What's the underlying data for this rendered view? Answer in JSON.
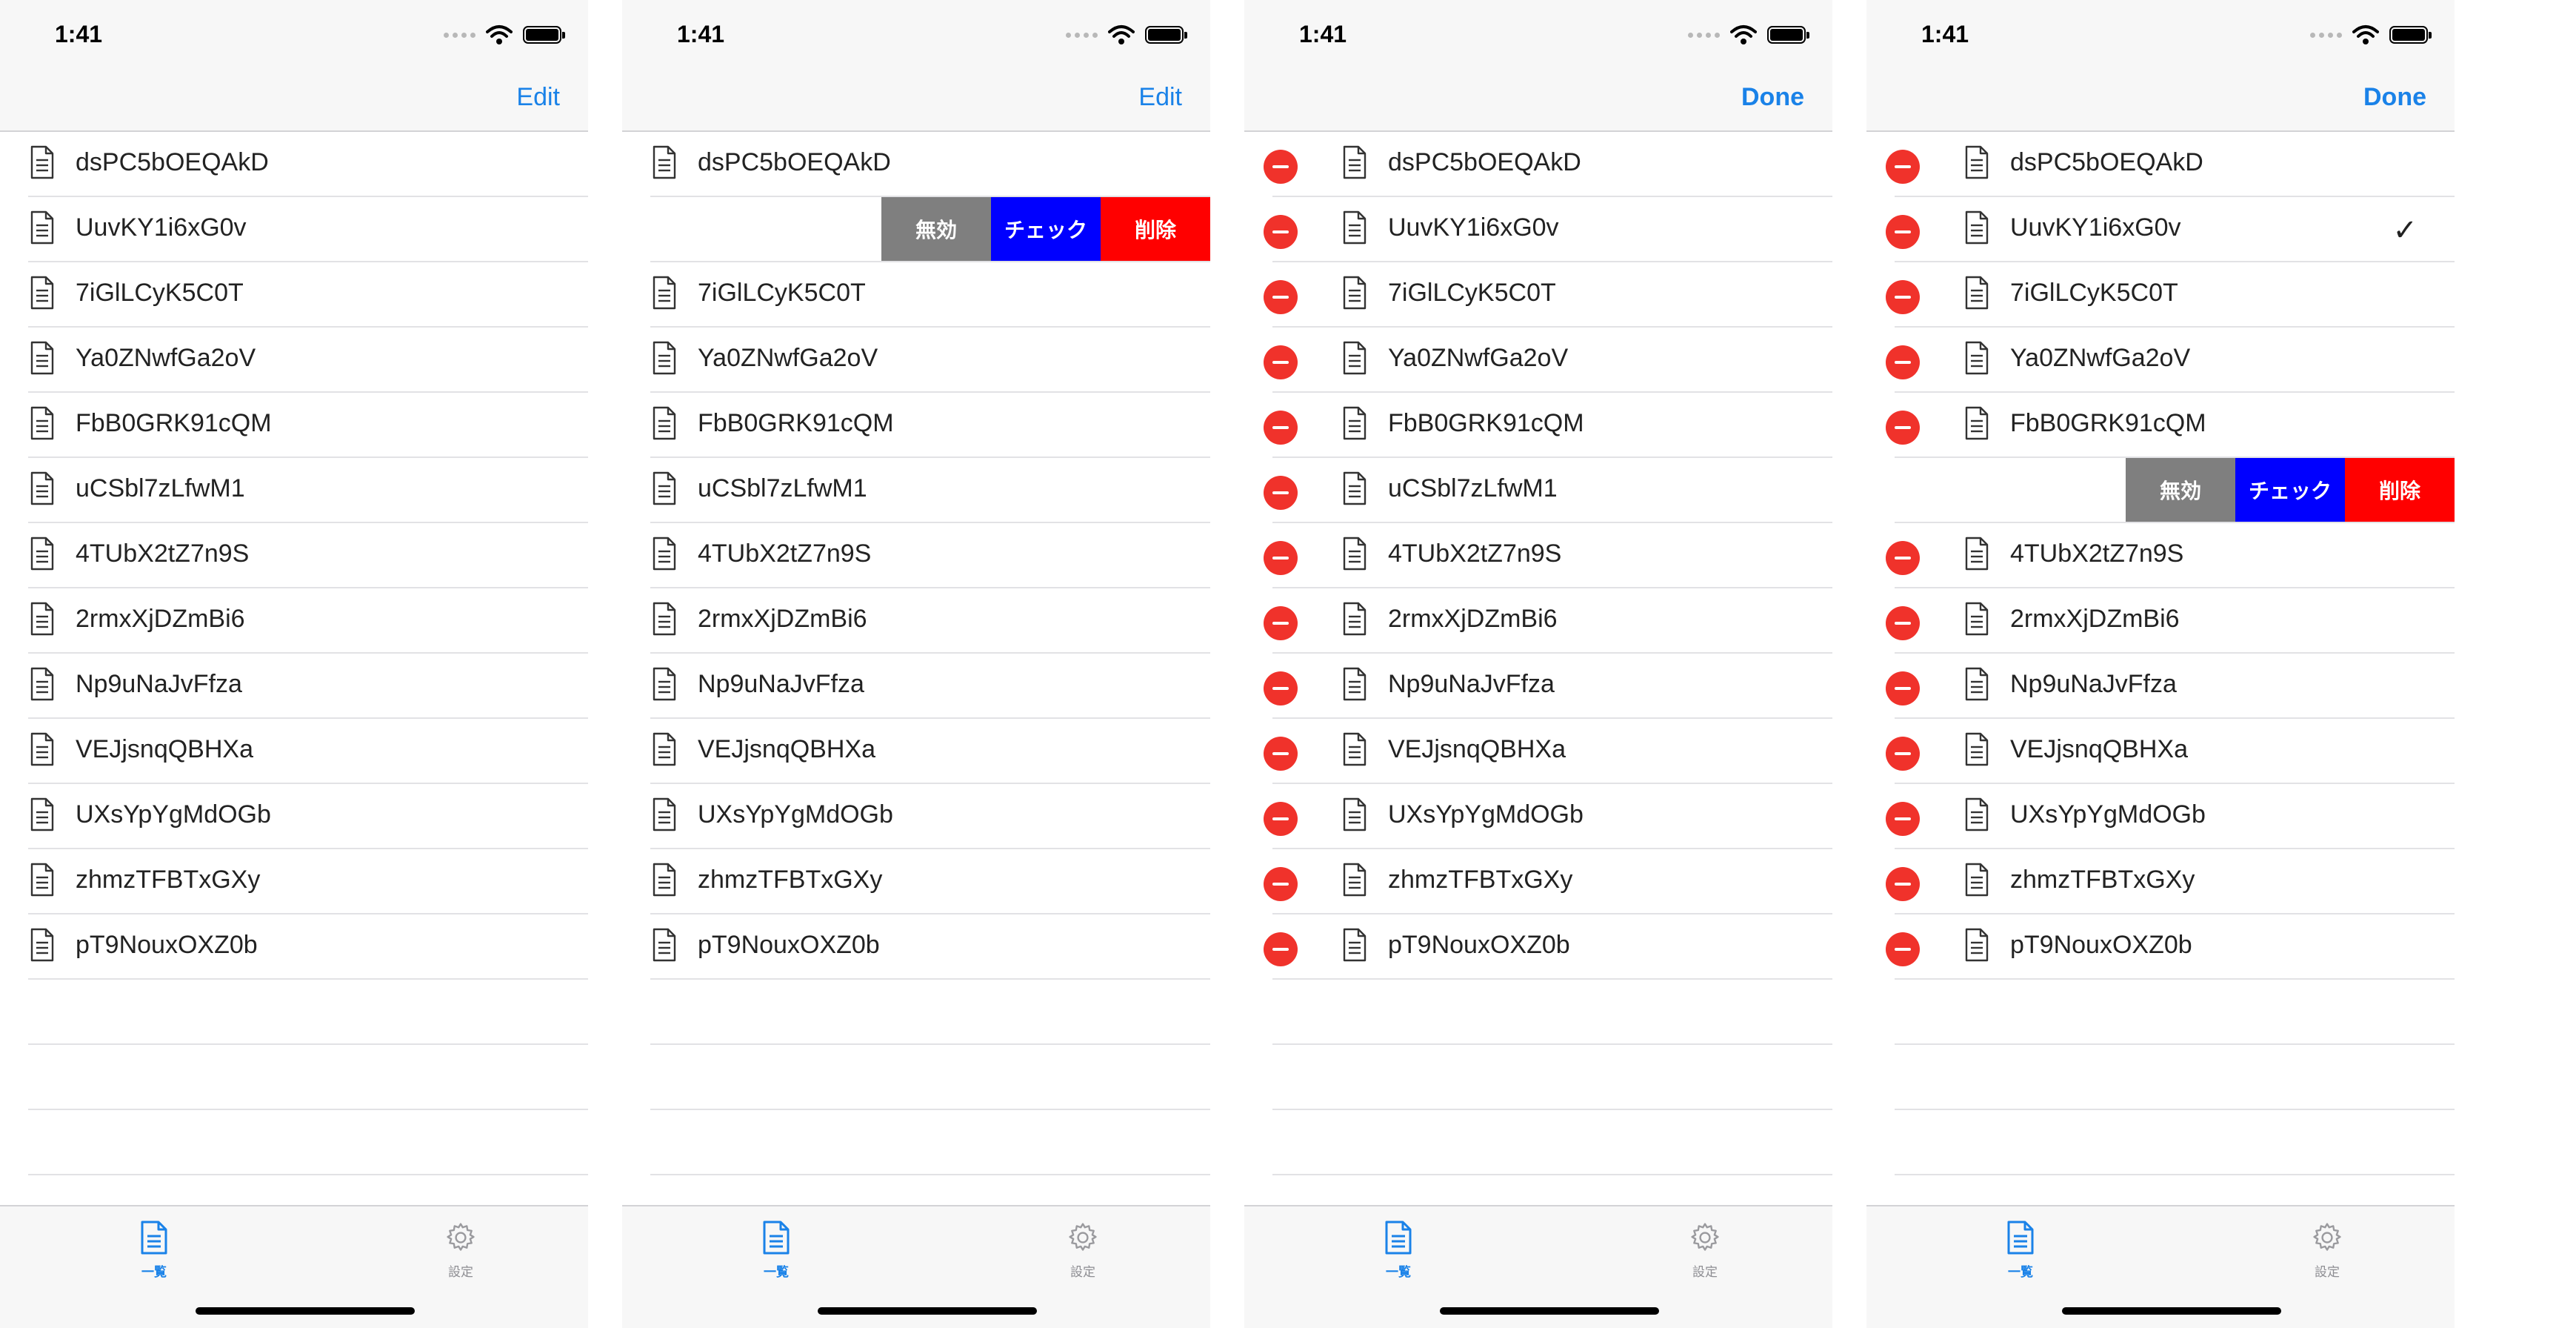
{
  "status": {
    "time": "1:41"
  },
  "items": [
    "dsPC5bOEQAkD",
    "UuvKY1i6xG0v",
    "7iGlLCyK5C0T",
    "Ya0ZNwfGa2oV",
    "FbB0GRK91cQM",
    "uCSbl7zLfwM1",
    "4TUbX2tZ7n9S",
    "2rmxXjDZmBi6",
    "Np9uNaJvFfza",
    "VEJjsnqQBHXa",
    "UXsYpYgMdOGb",
    "zhmzTFBTxGXy",
    "pT9NouxOXZ0b"
  ],
  "swipe_actions": {
    "disable": "無効",
    "check": "チェック",
    "delete": "削除"
  },
  "tabs": {
    "list": "一覧",
    "settings": "設定"
  },
  "check_mark": "✓",
  "colors": {
    "accent": "#1a82e8",
    "disable": "#7f7f7f",
    "check": "#0000ff",
    "delete": "#ff0000",
    "delete_control": "#f0322b"
  },
  "screens": [
    {
      "nav_button": "Edit",
      "editing": false,
      "swiped_index": -1,
      "checked_index": -1
    },
    {
      "nav_button": "Edit",
      "editing": false,
      "swiped_index": 1,
      "checked_index": -1
    },
    {
      "nav_button": "Done",
      "editing": true,
      "swiped_index": -1,
      "checked_index": -1
    },
    {
      "nav_button": "Done",
      "editing": true,
      "swiped_index": 5,
      "checked_index": 1
    }
  ]
}
